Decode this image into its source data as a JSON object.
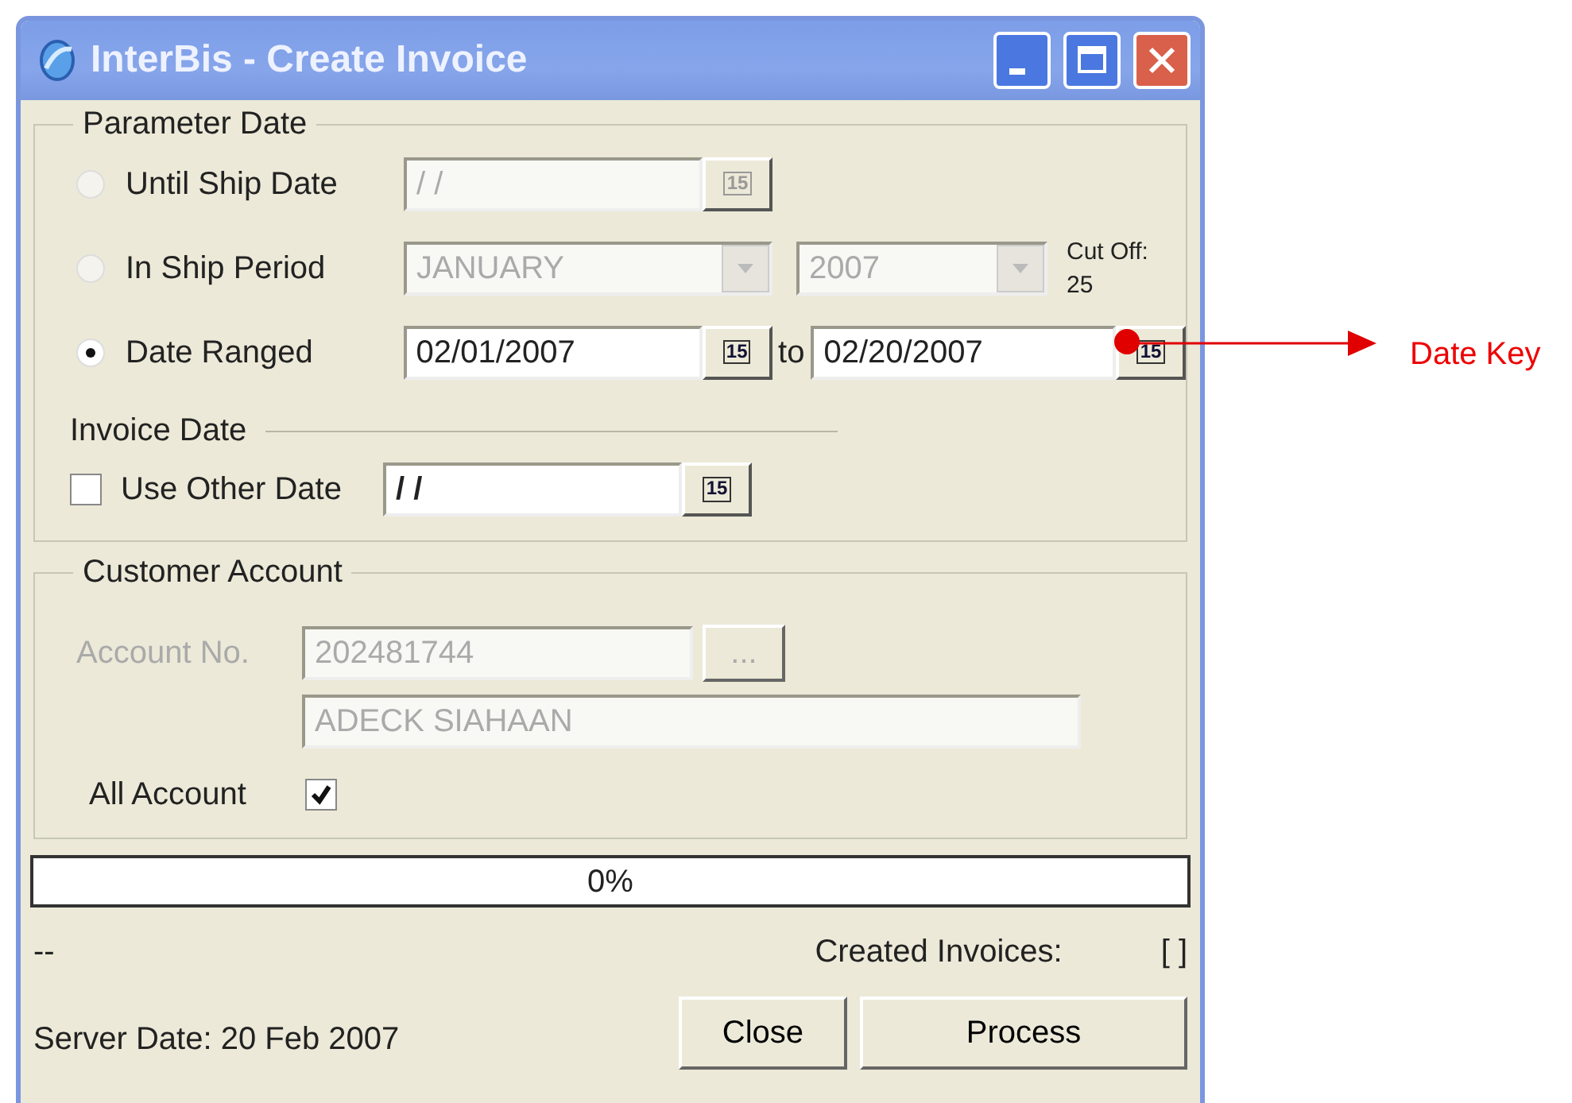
{
  "window": {
    "title": "InterBis - Create Invoice"
  },
  "parameter_date": {
    "label": "Parameter Date",
    "options": [
      {
        "kind": "date",
        "label": "Until Ship Date",
        "selected": false,
        "disabled": true,
        "value": "/ /",
        "calendar": "15"
      },
      {
        "kind": "period",
        "label": "In Ship Period",
        "selected": false,
        "disabled": true,
        "month": "JANUARY",
        "year": "2007",
        "cutoff_label": "Cut Off:",
        "cutoff_value": "25"
      },
      {
        "kind": "range",
        "label": "Date Ranged",
        "selected": true,
        "disabled": false,
        "value": "02/01/2007",
        "calendar": "15",
        "to_label": "to",
        "to_value": "02/20/2007",
        "to_calendar": "15"
      }
    ]
  },
  "invoice_date": {
    "label": "Invoice Date",
    "checkbox_label": "Use Other Date",
    "checked": false,
    "value": "/ /",
    "calendar": "15"
  },
  "customer_account": {
    "label": "Customer Account",
    "disabled": true,
    "account_no_label": "Account No.",
    "account_no": "202481744",
    "browse": "...",
    "name": "ADECK SIAHAAN",
    "all_account_label": "All Account",
    "all_account_checked": true
  },
  "progress": {
    "level": 0,
    "text": "0%"
  },
  "status": {
    "left": "--",
    "created_label": "Created Invoices:",
    "created_value": "[ ]",
    "server_date": "Server Date: 20 Feb 2007"
  },
  "buttons": [
    "Close",
    "Process"
  ],
  "annotation": {
    "text": "Date Key"
  }
}
